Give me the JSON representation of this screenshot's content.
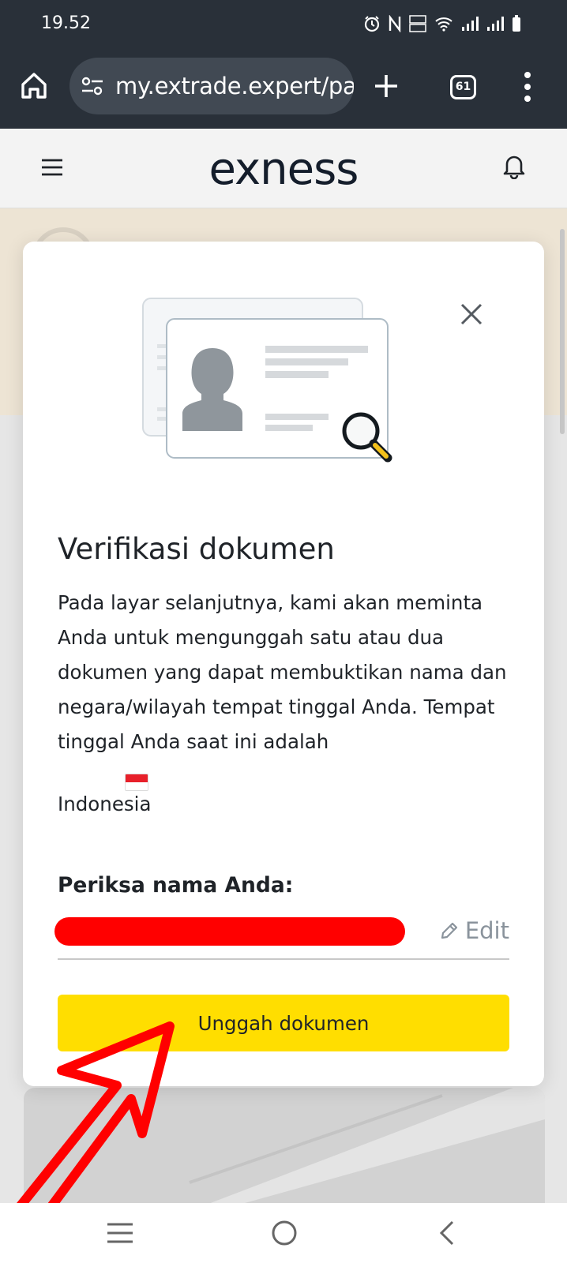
{
  "status_bar": {
    "time": "19.52"
  },
  "browser": {
    "url_visible": "my.extrade.expert/pa",
    "tabs_count": "61"
  },
  "site": {
    "brand": "exness"
  },
  "modal": {
    "title": "Verifikasi dokumen",
    "body": "Pada layar selanjutnya, kami akan meminta Anda untuk mengunggah satu atau dua dokumen yang dapat membuktikan nama dan negara/wilayah tempat tinggal Anda. Tempat tinggal Anda saat ini adalah",
    "country": "Indonesia",
    "check_name_label": "Periksa nama Anda:",
    "edit_label": "Edit",
    "upload_button": "Unggah dokumen"
  },
  "colors": {
    "accent_yellow": "#ffde00",
    "chrome_dark": "#293039",
    "annotation_red": "#ff0000"
  }
}
